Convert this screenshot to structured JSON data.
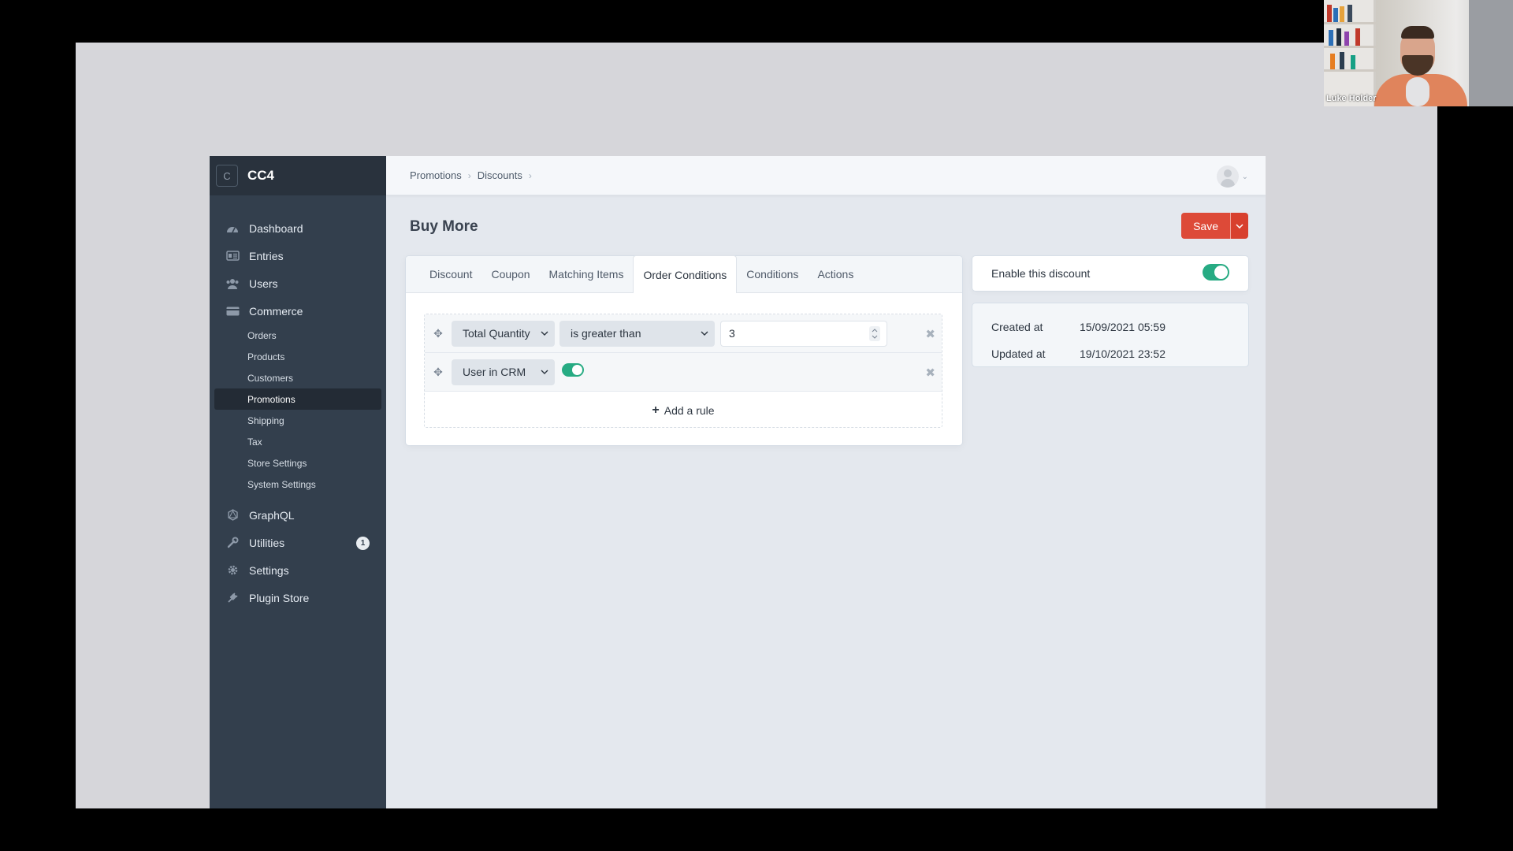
{
  "site": {
    "logo_letter": "C",
    "name": "CC4"
  },
  "nav": [
    {
      "label": "Dashboard",
      "icon": "dashboard-icon"
    },
    {
      "label": "Entries",
      "icon": "entries-icon"
    },
    {
      "label": "Users",
      "icon": "users-icon"
    },
    {
      "label": "Commerce",
      "icon": "commerce-icon"
    }
  ],
  "commerce_subnav": [
    "Orders",
    "Products",
    "Customers",
    "Promotions",
    "Shipping",
    "Tax",
    "Store Settings",
    "System Settings"
  ],
  "commerce_active": "Promotions",
  "nav_bottom": [
    {
      "label": "GraphQL",
      "icon": "graphql-icon"
    },
    {
      "label": "Utilities",
      "icon": "wrench-icon",
      "badge": "1"
    },
    {
      "label": "Settings",
      "icon": "gear-icon"
    },
    {
      "label": "Plugin Store",
      "icon": "plug-icon"
    }
  ],
  "breadcrumb": [
    "Promotions",
    "Discounts"
  ],
  "page": {
    "title": "Buy More",
    "save_label": "Save"
  },
  "tabs": [
    "Discount",
    "Coupon",
    "Matching Items",
    "Order Conditions",
    "Conditions",
    "Actions"
  ],
  "active_tab": "Order Conditions",
  "rules": {
    "row1": {
      "attribute": "Total Quantity",
      "operator": "is greater than",
      "value": "3"
    },
    "row2": {
      "attribute": "User in CRM",
      "toggle_on": true
    },
    "add_label": "Add a rule"
  },
  "side": {
    "enable_label": "Enable this discount",
    "enabled": true,
    "created_label": "Created at",
    "created_value": "15/09/2021 05:59",
    "updated_label": "Updated at",
    "updated_value": "19/10/2021 23:52"
  },
  "webcam": {
    "name": "Luke Holder"
  },
  "colors": {
    "sidebar": "#333f4d",
    "accent_red": "#dd4a38",
    "toggle_green": "#27ab83"
  }
}
